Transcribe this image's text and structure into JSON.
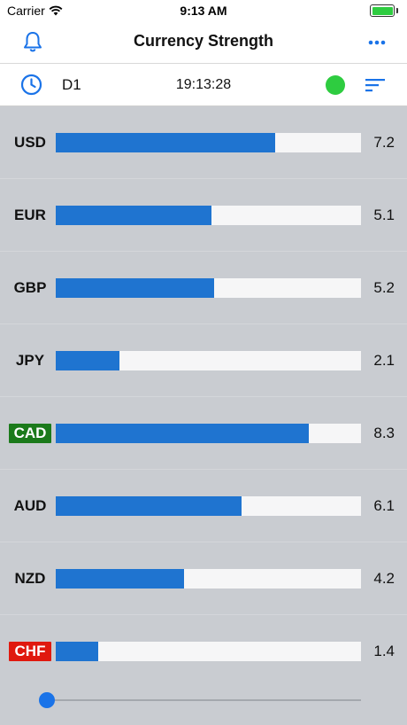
{
  "status_bar": {
    "carrier": "Carrier",
    "time": "9:13 AM"
  },
  "nav": {
    "title": "Currency Strength",
    "left_icon": "bell-icon",
    "right_icon": "more-icon"
  },
  "toolbar": {
    "timeframe": "D1",
    "server_time": "19:13:28",
    "status_color": "#2ecc40",
    "left_icon": "clock-icon",
    "right_icon": "sort-icon"
  },
  "currencies": [
    {
      "code": "USD",
      "value": "7.2",
      "fraction": 0.72,
      "highlight": ""
    },
    {
      "code": "EUR",
      "value": "5.1",
      "fraction": 0.51,
      "highlight": ""
    },
    {
      "code": "GBP",
      "value": "5.2",
      "fraction": 0.52,
      "highlight": ""
    },
    {
      "code": "JPY",
      "value": "2.1",
      "fraction": 0.21,
      "highlight": ""
    },
    {
      "code": "CAD",
      "value": "8.3",
      "fraction": 0.83,
      "highlight": "strongest"
    },
    {
      "code": "AUD",
      "value": "6.1",
      "fraction": 0.61,
      "highlight": ""
    },
    {
      "code": "NZD",
      "value": "4.2",
      "fraction": 0.42,
      "highlight": ""
    },
    {
      "code": "CHF",
      "value": "1.4",
      "fraction": 0.14,
      "highlight": "weakest"
    }
  ],
  "colors": {
    "bar": "#1f74d0",
    "strongest": "#1b7a1b",
    "weakest": "#e0190e",
    "accent": "#1a73e8"
  },
  "slider": {
    "position": 0
  }
}
